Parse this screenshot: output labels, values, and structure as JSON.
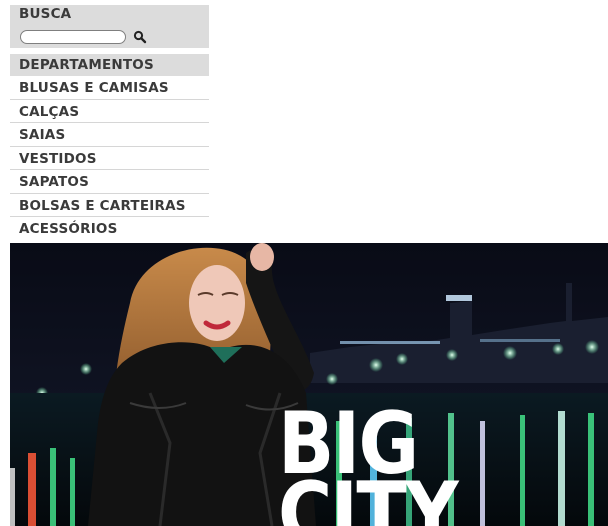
{
  "search": {
    "title": "BUSCA",
    "placeholder": ""
  },
  "departments": {
    "title": "DEPARTAMENTOS",
    "items": [
      "BLUSAS E CAMISAS",
      "CALÇAS",
      "SAIAS",
      "VESTIDOS",
      "SAPATOS",
      "BOLSAS E CARTEIRAS",
      "ACESSÓRIOS"
    ]
  },
  "banner": {
    "line1": "BIG",
    "line2": "CITY"
  },
  "colors": {
    "sidebar_bg": "#dcdcdc",
    "text": "#3a3a3a",
    "banner_sky": "#0b0d18"
  }
}
